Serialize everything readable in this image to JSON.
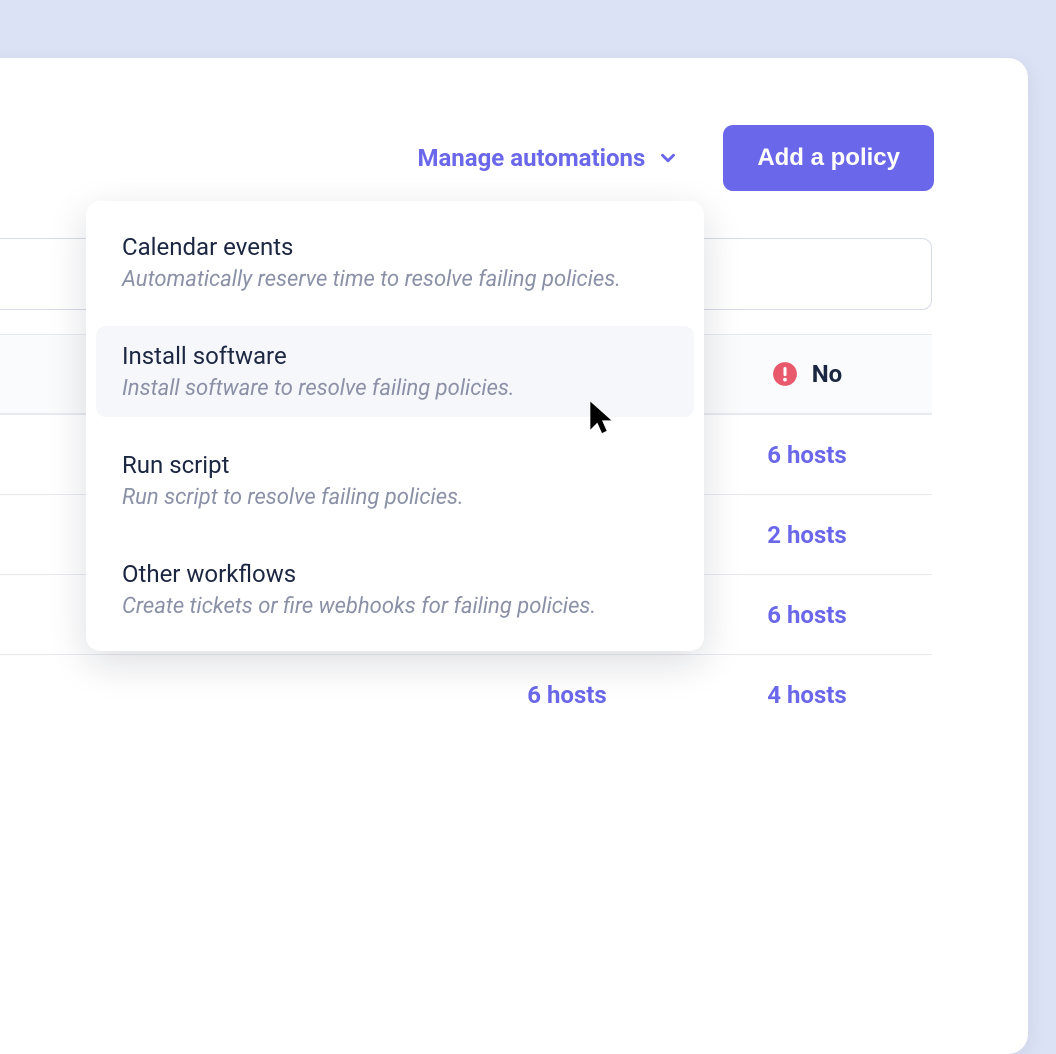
{
  "header": {
    "manage_label": "Manage automations",
    "add_policy_label": "Add a policy"
  },
  "dropdown": {
    "items": [
      {
        "title": "Calendar events",
        "subtitle": "Automatically reserve time to resolve failing policies.",
        "highlighted": false
      },
      {
        "title": "Install software",
        "subtitle": "Install software to resolve failing policies.",
        "highlighted": true
      },
      {
        "title": "Run script",
        "subtitle": "Run script to resolve failing policies.",
        "highlighted": false
      },
      {
        "title": "Other workflows",
        "subtitle": "Create tickets or fire webhooks for failing policies.",
        "highlighted": false
      }
    ]
  },
  "table": {
    "no_header": "No",
    "rows": [
      {
        "left": "",
        "right": "6 hosts"
      },
      {
        "left": "",
        "right": "2 hosts"
      },
      {
        "left": "",
        "right": "6 hosts"
      },
      {
        "left": "6 hosts",
        "right": "4 hosts"
      }
    ]
  }
}
